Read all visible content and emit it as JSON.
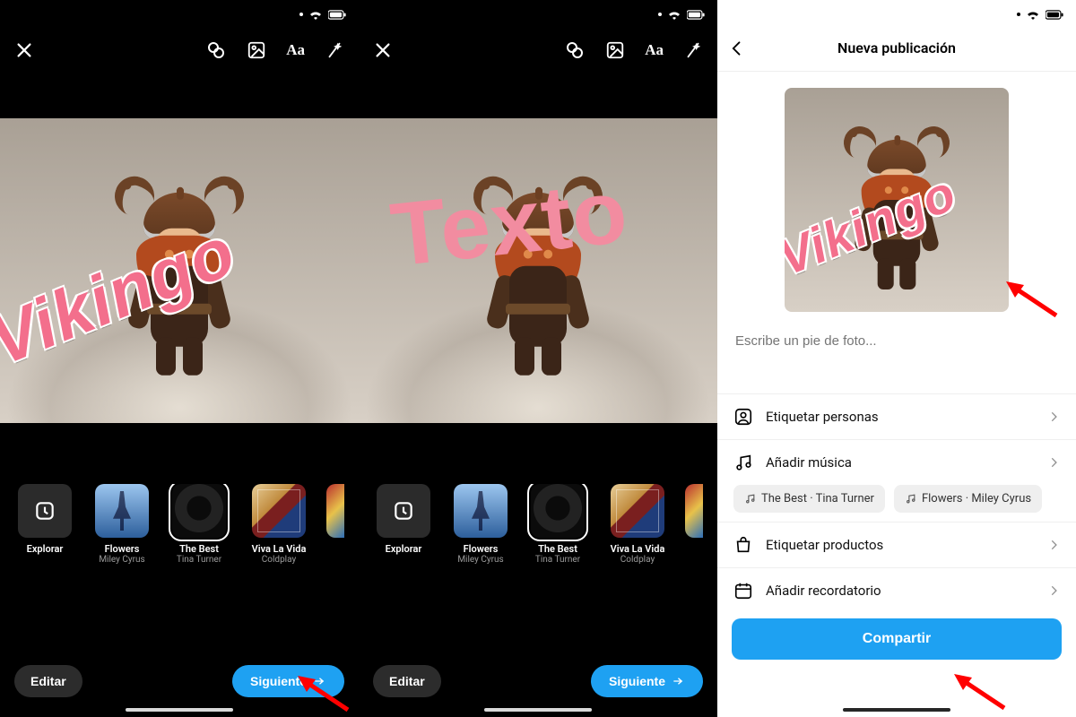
{
  "status": {
    "wifi": "wifi",
    "battery": "battery"
  },
  "editScreen": {
    "toolbar": {
      "close": "×",
      "tools": [
        "loop-icon",
        "image-icon",
        "text-icon",
        "sparkle-icon"
      ]
    },
    "overlays": {
      "vikingo": "Vikingo",
      "texto": "Texto"
    },
    "music": {
      "explore": "Explorar",
      "items": [
        {
          "title": "Flowers",
          "artist": "Miley Cyrus"
        },
        {
          "title": "The Best",
          "artist": "Tina Turner"
        },
        {
          "title": "Viva La Vida",
          "artist": "Coldplay"
        }
      ]
    },
    "buttons": {
      "edit": "Editar",
      "next": "Siguiente"
    }
  },
  "publishScreen": {
    "title": "Nueva publicación",
    "caption_placeholder": "Escribe un pie de foto...",
    "options": {
      "tag_people": "Etiquetar personas",
      "add_music": "Añadir música",
      "tag_products": "Etiquetar productos",
      "add_reminder": "Añadir recordatorio"
    },
    "music_chips": [
      "The Best · Tina Turner",
      "Flowers · Miley Cyrus"
    ],
    "share": "Compartir"
  }
}
